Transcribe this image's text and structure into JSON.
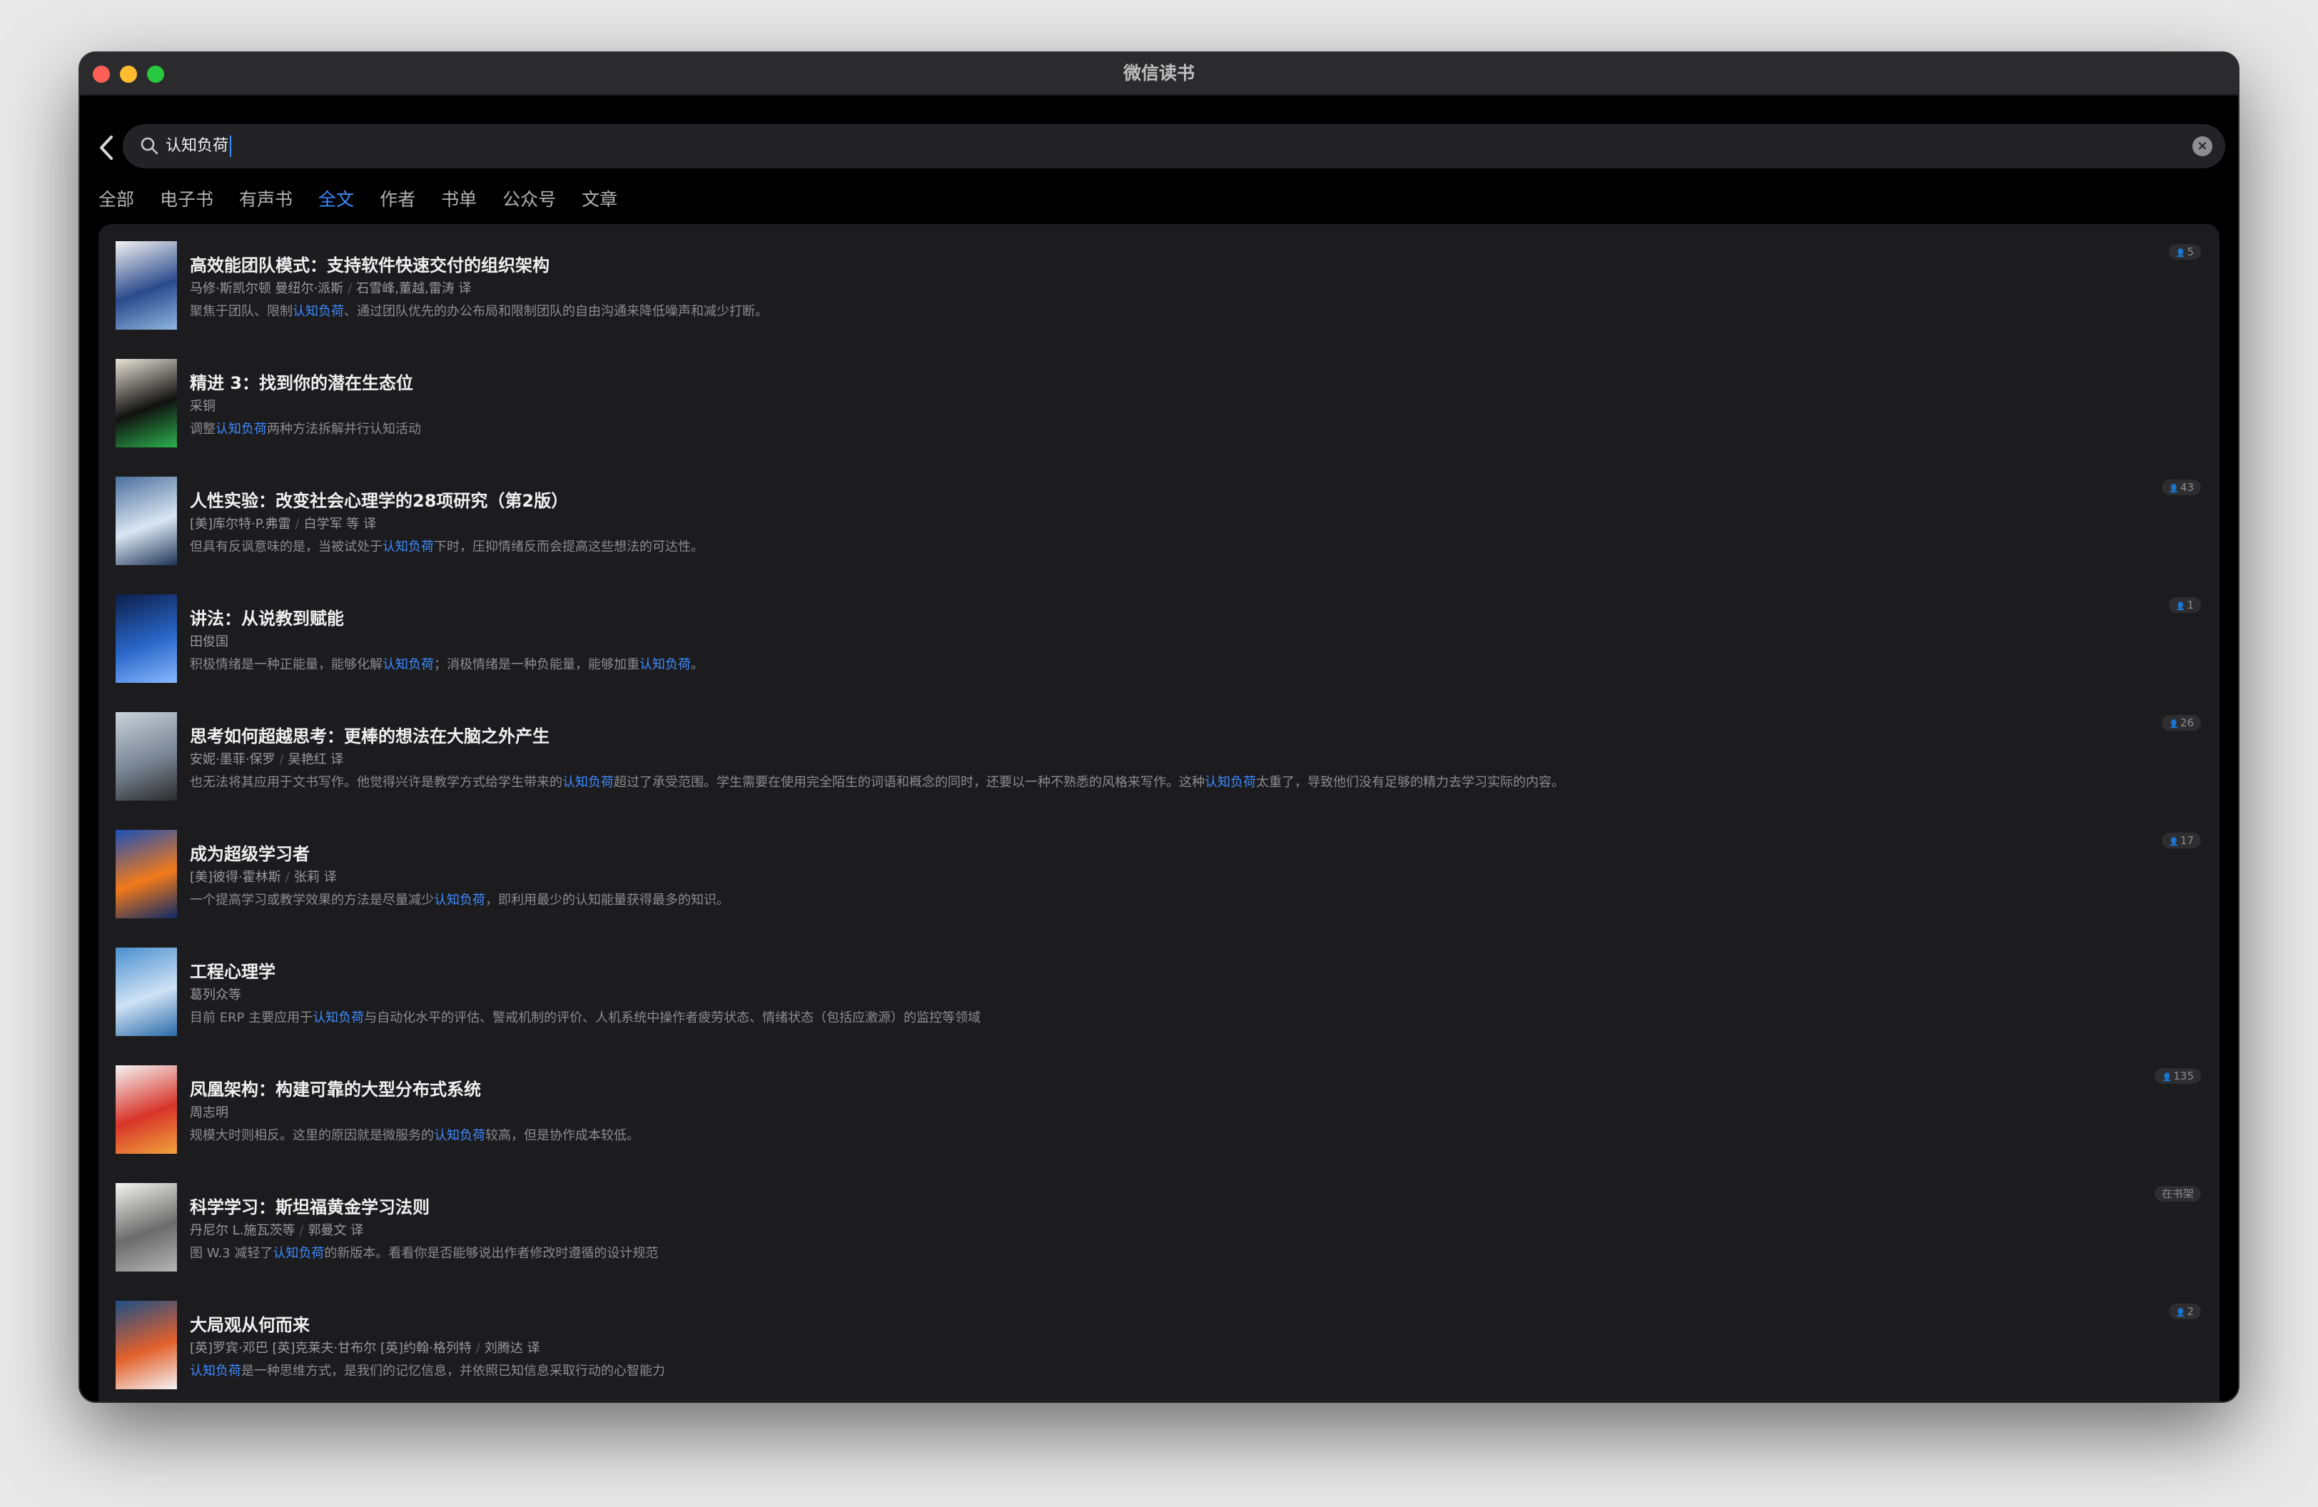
{
  "window": {
    "title": "微信读书"
  },
  "search": {
    "query": "认知负荷"
  },
  "tabs": [
    {
      "label": "全部",
      "active": false
    },
    {
      "label": "电子书",
      "active": false
    },
    {
      "label": "有声书",
      "active": false
    },
    {
      "label": "全文",
      "active": true
    },
    {
      "label": "作者",
      "active": false
    },
    {
      "label": "书单",
      "active": false
    },
    {
      "label": "公众号",
      "active": false
    },
    {
      "label": "文章",
      "active": false
    }
  ],
  "results": [
    {
      "title": "高效能团队模式：支持软件快速交付的组织架构",
      "author": "马修·斯凯尔顿 曼纽尔·派斯",
      "translator": "石雪峰,董越,雷涛 译",
      "snippet": [
        {
          "t": "聚焦于团队、限制"
        },
        {
          "t": "认知负荷",
          "hl": true
        },
        {
          "t": "、通过团队优先的办公布局和限制团队的自由沟通来降低噪声和减少打断。"
        }
      ],
      "badge": "5",
      "cover_colors": [
        "#f3f3f3",
        "#2b4a8c",
        "#8fb6e0"
      ]
    },
    {
      "title": "精进 3：找到你的潜在生态位",
      "author": "采铜",
      "translator": "",
      "snippet": [
        {
          "t": "调整"
        },
        {
          "t": "认知负荷",
          "hl": true
        },
        {
          "t": "两种方法拆解并行认知活动"
        }
      ],
      "badge": "",
      "cover_colors": [
        "#e7e4d8",
        "#111111",
        "#2bb24c"
      ]
    },
    {
      "title": "人性实验：改变社会心理学的28项研究（第2版）",
      "author": "[美]库尔特·P.弗雷",
      "translator": "白学军 等 译",
      "snippet": [
        {
          "t": "但具有反讽意味的是，当被试处于"
        },
        {
          "t": "认知负荷",
          "hl": true
        },
        {
          "t": "下时，压抑情绪反而会提高这些想法的可达性。"
        }
      ],
      "badge": "43",
      "cover_colors": [
        "#4a6f9e",
        "#dbe6f2",
        "#1e3457"
      ]
    },
    {
      "title": "讲法：从说教到赋能",
      "author": "田俊国",
      "translator": "",
      "snippet": [
        {
          "t": "积极情绪是一种正能量，能够化解"
        },
        {
          "t": "认知负荷",
          "hl": true
        },
        {
          "t": "；消极情绪是一种负能量，能够加重"
        },
        {
          "t": "认知负荷",
          "hl": true
        },
        {
          "t": "。"
        }
      ],
      "badge": "1",
      "cover_colors": [
        "#0c1e4a",
        "#2a66c8",
        "#89b8ff"
      ]
    },
    {
      "title": "思考如何超越思考：更棒的想法在大脑之外产生",
      "author": "安妮·墨菲·保罗",
      "translator": "吴艳红 译",
      "snippet": [
        {
          "t": "也无法将其应用于文书写作。他觉得兴许是教学方式给学生带来的"
        },
        {
          "t": "认知负荷",
          "hl": true
        },
        {
          "t": "超过了承受范围。学生需要在使用完全陌生的词语和概念的同时，还要以一种不熟悉的风格来写作。这种"
        },
        {
          "t": "认知负荷",
          "hl": true
        },
        {
          "t": "太重了，导致他们没有足够的精力去学习实际的内容。"
        }
      ],
      "badge": "26",
      "cover_colors": [
        "#c9d1da",
        "#7a8594",
        "#2b2b2b"
      ]
    },
    {
      "title": "成为超级学习者",
      "author": "[美]彼得·霍林斯",
      "translator": "张莉 译",
      "snippet": [
        {
          "t": "一个提高学习或教学效果的方法是尽量减少"
        },
        {
          "t": "认知负荷",
          "hl": true
        },
        {
          "t": "，即利用最少的认知能量获得最多的知识。"
        }
      ],
      "badge": "17",
      "cover_colors": [
        "#1b4fb8",
        "#f27a1a",
        "#0d2a66"
      ]
    },
    {
      "title": "工程心理学",
      "author": "葛列众等",
      "translator": "",
      "snippet": [
        {
          "t": "目前 ERP 主要应用于"
        },
        {
          "t": "认知负荷",
          "hl": true
        },
        {
          "t": "与自动化水平的评估、警戒机制的评价、人机系统中操作者疲劳状态、情绪状态（包括应激源）的监控等领域"
        }
      ],
      "badge": "",
      "cover_colors": [
        "#4a8fd0",
        "#cfe2f5",
        "#2b6aa8"
      ]
    },
    {
      "title": "凤凰架构：构建可靠的大型分布式系统",
      "author": "周志明",
      "translator": "",
      "snippet": [
        {
          "t": "规模大时则相反。这里的原因就是微服务的"
        },
        {
          "t": "认知负荷",
          "hl": true
        },
        {
          "t": "较高，但是协作成本较低。"
        }
      ],
      "badge": "135",
      "cover_colors": [
        "#f5f5f5",
        "#d8342a",
        "#f0a43a"
      ]
    },
    {
      "title": "科学学习：斯坦福黄金学习法则",
      "author": "丹尼尔 L.施瓦茨等",
      "translator": "郭曼文 译",
      "snippet": [
        {
          "t": "图 W.3 减轻了"
        },
        {
          "t": "认知负荷",
          "hl": true
        },
        {
          "t": "的新版本。看看你是否能够说出作者修改时遵循的设计规范"
        }
      ],
      "badge": "在书架",
      "cover_colors": [
        "#f4f4f2",
        "#6b6b6b",
        "#b5b5b5"
      ]
    },
    {
      "title": "大局观从何而来",
      "author": "[英]罗宾·邓巴 [英]克莱夫·甘布尔 [英]约翰·格列特",
      "translator": "刘腾达 译",
      "snippet": [
        {
          "t": "认知负荷",
          "hl": true
        },
        {
          "t": "是一种思维方式，是我们的记忆信息，并依照已知信息采取行动的心智能力"
        }
      ],
      "badge": "2",
      "cover_colors": [
        "#1d4f86",
        "#e3602c",
        "#f4f4f4"
      ]
    }
  ]
}
